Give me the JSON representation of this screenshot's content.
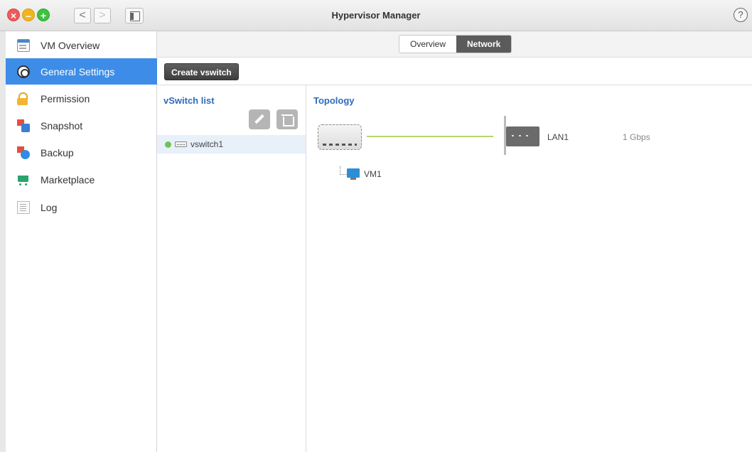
{
  "window": {
    "title": "Hypervisor Manager",
    "help_label": "?",
    "back_label": "<",
    "forward_label": ">"
  },
  "sidebar": {
    "items": [
      {
        "label": "VM Overview",
        "icon": "vm-overview-icon",
        "active": false
      },
      {
        "label": "General Settings",
        "icon": "gear-icon",
        "active": true
      },
      {
        "label": "Permission",
        "icon": "lock-icon",
        "active": false
      },
      {
        "label": "Snapshot",
        "icon": "snapshot-icon",
        "active": false
      },
      {
        "label": "Backup",
        "icon": "backup-icon",
        "active": false
      },
      {
        "label": "Marketplace",
        "icon": "cart-icon",
        "active": false
      },
      {
        "label": "Log",
        "icon": "log-icon",
        "active": false
      }
    ]
  },
  "tabs": [
    {
      "label": "Overview",
      "active": false
    },
    {
      "label": "Network",
      "active": true
    }
  ],
  "toolbar": {
    "create_label": "Create vswitch"
  },
  "vswitch_list": {
    "title": "vSwitch list",
    "items": [
      {
        "name": "vswitch1",
        "status": "online"
      }
    ]
  },
  "topology": {
    "title": "Topology",
    "adapter": {
      "name": "LAN1",
      "speed": "1 Gbps"
    },
    "vms": [
      "VM1"
    ]
  },
  "colors": {
    "accent": "#3d8de8",
    "link_title": "#2f6bbd",
    "status_online": "#6dc456",
    "topology_link": "#b8d36a"
  }
}
